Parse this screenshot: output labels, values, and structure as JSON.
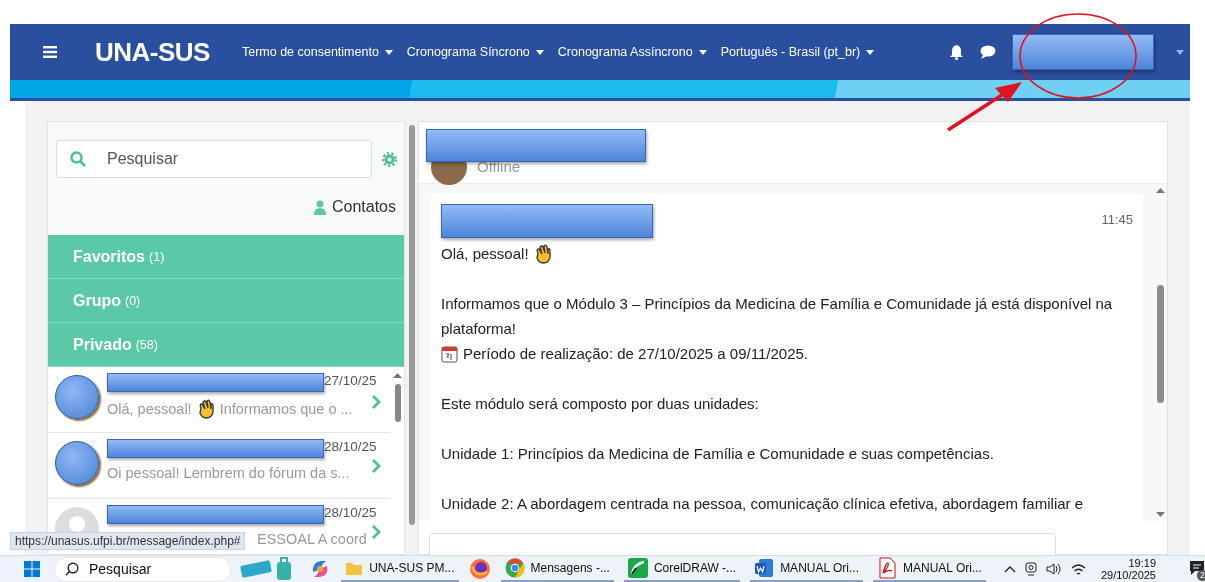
{
  "navbar": {
    "logo": "UNA-SUS",
    "menus": [
      "Termo de consentimento",
      "Cronograma Síncrono",
      "Cronograma Assíncrono",
      "Português - Brasil (pt_br)"
    ]
  },
  "sidebar": {
    "search": {
      "placeholder": "Pesquisar"
    },
    "contacts": "Contatos",
    "sections": [
      {
        "label": "Favoritos",
        "count": "(1)"
      },
      {
        "label": "Grupo",
        "count": "(0)"
      },
      {
        "label": "Privado",
        "count": "(58)"
      }
    ],
    "conversations": [
      {
        "kind": "photo",
        "date": "27/10/25",
        "preview": [
          {
            "kind": "text",
            "text": "Olá, pessoal!"
          },
          {
            "kind": "emoji"
          },
          {
            "kind": "text",
            "text": "Informamos que o ..."
          }
        ]
      },
      {
        "kind": "photo",
        "date": "28/10/25",
        "preview": [
          {
            "kind": "text",
            "text": "Oi pessoal! Lembrem do fórum da s..."
          }
        ]
      },
      {
        "kind": "placeholder",
        "date": "28/10/25",
        "preview": [
          {
            "kind": "text",
            "text": "ESSOAL A coord"
          }
        ]
      }
    ]
  },
  "chat": {
    "status": "Offline",
    "message": {
      "time": "11:45",
      "paragraphs": [
        [
          {
            "text": "Olá, pessoal!",
            "kind": "greeting"
          }
        ],
        [
          {
            "text": "Informamos que o Módulo 3 – Princípios da Medicina de Família e Comunidade já está disponível na plataforma!",
            "kind": "text"
          },
          {
            "text": "Período de realização: de 27/10/2025 a 09/11/2025.",
            "kind": "date"
          }
        ],
        [
          {
            "text": "Este módulo será composto por duas unidades:"
          }
        ],
        [
          {
            "text": "Unidade 1: Princípios da Medicina de Família e Comunidade e suas competências."
          }
        ],
        [
          {
            "text": "Unidade 2: A abordagem centrada na pessoa, comunicação clínica efetiva, abordagem familiar e"
          }
        ]
      ]
    }
  },
  "status_url": "https://unasus.ufpi.br/message/index.php#",
  "taskbar": {
    "search": "Pesquisar",
    "apps": [
      "UNA-SUS PM...",
      "Mensagens -...",
      "CorelDRAW -...",
      "MANUAL Ori...",
      "MANUAL Ori..."
    ],
    "clock": {
      "time": "19:19",
      "date": "29/10/2025"
    },
    "notifications": "2"
  }
}
